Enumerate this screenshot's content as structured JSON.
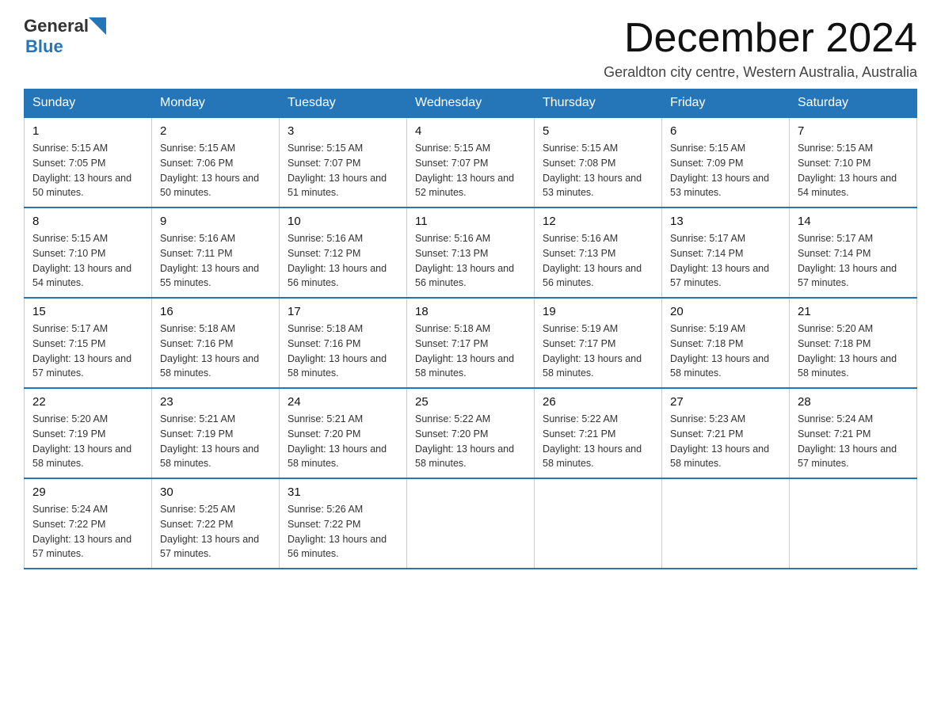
{
  "header": {
    "logo_general": "General",
    "logo_blue": "Blue",
    "month_title": "December 2024",
    "subtitle": "Geraldton city centre, Western Australia, Australia"
  },
  "days_of_week": [
    "Sunday",
    "Monday",
    "Tuesday",
    "Wednesday",
    "Thursday",
    "Friday",
    "Saturday"
  ],
  "weeks": [
    [
      {
        "day": "1",
        "sunrise": "5:15 AM",
        "sunset": "7:05 PM",
        "daylight": "13 hours and 50 minutes."
      },
      {
        "day": "2",
        "sunrise": "5:15 AM",
        "sunset": "7:06 PM",
        "daylight": "13 hours and 50 minutes."
      },
      {
        "day": "3",
        "sunrise": "5:15 AM",
        "sunset": "7:07 PM",
        "daylight": "13 hours and 51 minutes."
      },
      {
        "day": "4",
        "sunrise": "5:15 AM",
        "sunset": "7:07 PM",
        "daylight": "13 hours and 52 minutes."
      },
      {
        "day": "5",
        "sunrise": "5:15 AM",
        "sunset": "7:08 PM",
        "daylight": "13 hours and 53 minutes."
      },
      {
        "day": "6",
        "sunrise": "5:15 AM",
        "sunset": "7:09 PM",
        "daylight": "13 hours and 53 minutes."
      },
      {
        "day": "7",
        "sunrise": "5:15 AM",
        "sunset": "7:10 PM",
        "daylight": "13 hours and 54 minutes."
      }
    ],
    [
      {
        "day": "8",
        "sunrise": "5:15 AM",
        "sunset": "7:10 PM",
        "daylight": "13 hours and 54 minutes."
      },
      {
        "day": "9",
        "sunrise": "5:16 AM",
        "sunset": "7:11 PM",
        "daylight": "13 hours and 55 minutes."
      },
      {
        "day": "10",
        "sunrise": "5:16 AM",
        "sunset": "7:12 PM",
        "daylight": "13 hours and 56 minutes."
      },
      {
        "day": "11",
        "sunrise": "5:16 AM",
        "sunset": "7:13 PM",
        "daylight": "13 hours and 56 minutes."
      },
      {
        "day": "12",
        "sunrise": "5:16 AM",
        "sunset": "7:13 PM",
        "daylight": "13 hours and 56 minutes."
      },
      {
        "day": "13",
        "sunrise": "5:17 AM",
        "sunset": "7:14 PM",
        "daylight": "13 hours and 57 minutes."
      },
      {
        "day": "14",
        "sunrise": "5:17 AM",
        "sunset": "7:14 PM",
        "daylight": "13 hours and 57 minutes."
      }
    ],
    [
      {
        "day": "15",
        "sunrise": "5:17 AM",
        "sunset": "7:15 PM",
        "daylight": "13 hours and 57 minutes."
      },
      {
        "day": "16",
        "sunrise": "5:18 AM",
        "sunset": "7:16 PM",
        "daylight": "13 hours and 58 minutes."
      },
      {
        "day": "17",
        "sunrise": "5:18 AM",
        "sunset": "7:16 PM",
        "daylight": "13 hours and 58 minutes."
      },
      {
        "day": "18",
        "sunrise": "5:18 AM",
        "sunset": "7:17 PM",
        "daylight": "13 hours and 58 minutes."
      },
      {
        "day": "19",
        "sunrise": "5:19 AM",
        "sunset": "7:17 PM",
        "daylight": "13 hours and 58 minutes."
      },
      {
        "day": "20",
        "sunrise": "5:19 AM",
        "sunset": "7:18 PM",
        "daylight": "13 hours and 58 minutes."
      },
      {
        "day": "21",
        "sunrise": "5:20 AM",
        "sunset": "7:18 PM",
        "daylight": "13 hours and 58 minutes."
      }
    ],
    [
      {
        "day": "22",
        "sunrise": "5:20 AM",
        "sunset": "7:19 PM",
        "daylight": "13 hours and 58 minutes."
      },
      {
        "day": "23",
        "sunrise": "5:21 AM",
        "sunset": "7:19 PM",
        "daylight": "13 hours and 58 minutes."
      },
      {
        "day": "24",
        "sunrise": "5:21 AM",
        "sunset": "7:20 PM",
        "daylight": "13 hours and 58 minutes."
      },
      {
        "day": "25",
        "sunrise": "5:22 AM",
        "sunset": "7:20 PM",
        "daylight": "13 hours and 58 minutes."
      },
      {
        "day": "26",
        "sunrise": "5:22 AM",
        "sunset": "7:21 PM",
        "daylight": "13 hours and 58 minutes."
      },
      {
        "day": "27",
        "sunrise": "5:23 AM",
        "sunset": "7:21 PM",
        "daylight": "13 hours and 58 minutes."
      },
      {
        "day": "28",
        "sunrise": "5:24 AM",
        "sunset": "7:21 PM",
        "daylight": "13 hours and 57 minutes."
      }
    ],
    [
      {
        "day": "29",
        "sunrise": "5:24 AM",
        "sunset": "7:22 PM",
        "daylight": "13 hours and 57 minutes."
      },
      {
        "day": "30",
        "sunrise": "5:25 AM",
        "sunset": "7:22 PM",
        "daylight": "13 hours and 57 minutes."
      },
      {
        "day": "31",
        "sunrise": "5:26 AM",
        "sunset": "7:22 PM",
        "daylight": "13 hours and 56 minutes."
      },
      null,
      null,
      null,
      null
    ]
  ],
  "labels": {
    "sunrise_prefix": "Sunrise: ",
    "sunset_prefix": "Sunset: ",
    "daylight_prefix": "Daylight: "
  },
  "colors": {
    "header_bg": "#2576b8",
    "border_blue": "#2576b8"
  }
}
